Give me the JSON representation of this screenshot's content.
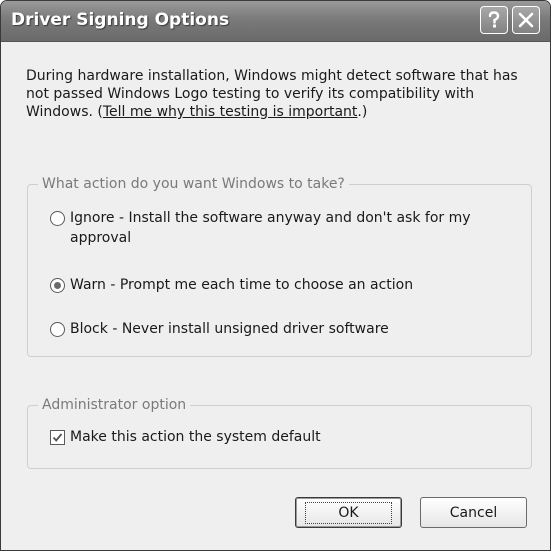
{
  "window": {
    "title": "Driver Signing Options",
    "help_icon": "question-icon",
    "close_icon": "close-icon"
  },
  "description": {
    "text": "During hardware installation, Windows might detect software that has not passed Windows Logo testing to verify its compatibility with Windows. (",
    "link": "Tell me why this testing is important",
    "suffix": ".)"
  },
  "action_group": {
    "legend": "What action do you want Windows to take?",
    "options": [
      {
        "label": "Ignore - Install the software anyway and don't ask for my approval",
        "selected": false
      },
      {
        "label": "Warn - Prompt me each time to choose an action",
        "selected": true
      },
      {
        "label": "Block - Never install unsigned driver software",
        "selected": false
      }
    ]
  },
  "admin_group": {
    "legend": "Administrator option",
    "checkbox_label": "Make this action the system default",
    "checked": true
  },
  "buttons": {
    "ok": "OK",
    "cancel": "Cancel"
  }
}
